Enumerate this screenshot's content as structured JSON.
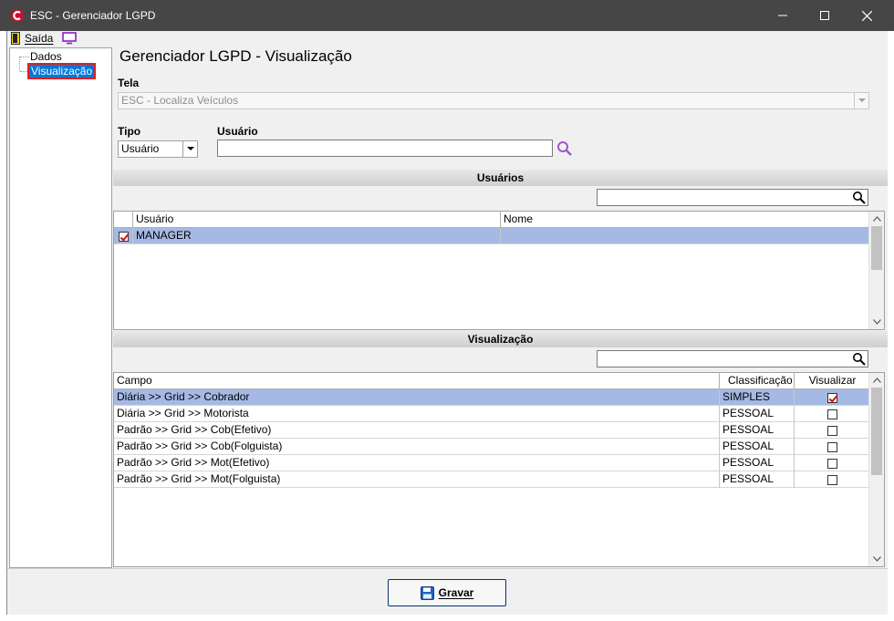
{
  "window": {
    "title": "ESC - Gerenciador LGPD"
  },
  "menu": {
    "exit_label": "Saída"
  },
  "tree": {
    "items": [
      {
        "label": "Dados"
      },
      {
        "label": "Visualização"
      }
    ]
  },
  "main": {
    "page_title": "Gerenciador LGPD - Visualização",
    "tela": {
      "label": "Tela",
      "value": "ESC - Localiza Veículos"
    },
    "tipo": {
      "label": "Tipo",
      "value": "Usuário"
    },
    "usuario": {
      "label": "Usuário",
      "value": ""
    }
  },
  "usuarios_section": {
    "header": "Usuários",
    "search_value": "",
    "columns": [
      "Usuário",
      "Nome"
    ],
    "rows": [
      {
        "checked": true,
        "usuario": "MANAGER",
        "nome": ""
      }
    ]
  },
  "visualizacao_section": {
    "header": "Visualização",
    "search_value": "",
    "columns": [
      "Campo",
      "Classificação",
      "Visualizar"
    ],
    "rows": [
      {
        "campo": "Diária >> Grid >> Cobrador",
        "classificacao": "SIMPLES",
        "visualizar": true
      },
      {
        "campo": "Diária >> Grid >> Motorista",
        "classificacao": "PESSOAL",
        "visualizar": false
      },
      {
        "campo": "Padrão >> Grid >> Cob(Efetivo)",
        "classificacao": "PESSOAL",
        "visualizar": false
      },
      {
        "campo": "Padrão >> Grid >> Cob(Folguista)",
        "classificacao": "PESSOAL",
        "visualizar": false
      },
      {
        "campo": "Padrão >> Grid >> Mot(Efetivo)",
        "classificacao": "PESSOAL",
        "visualizar": false
      },
      {
        "campo": "Padrão >> Grid >> Mot(Folguista)",
        "classificacao": "PESSOAL",
        "visualizar": false
      }
    ]
  },
  "footer": {
    "save_label": "Gravar"
  },
  "colors": {
    "titlebar": "#464646",
    "selection": "#a5b9e4",
    "tree_selection": "#0078d7",
    "check": "#d01010",
    "search_accent": "#9b59d0"
  }
}
